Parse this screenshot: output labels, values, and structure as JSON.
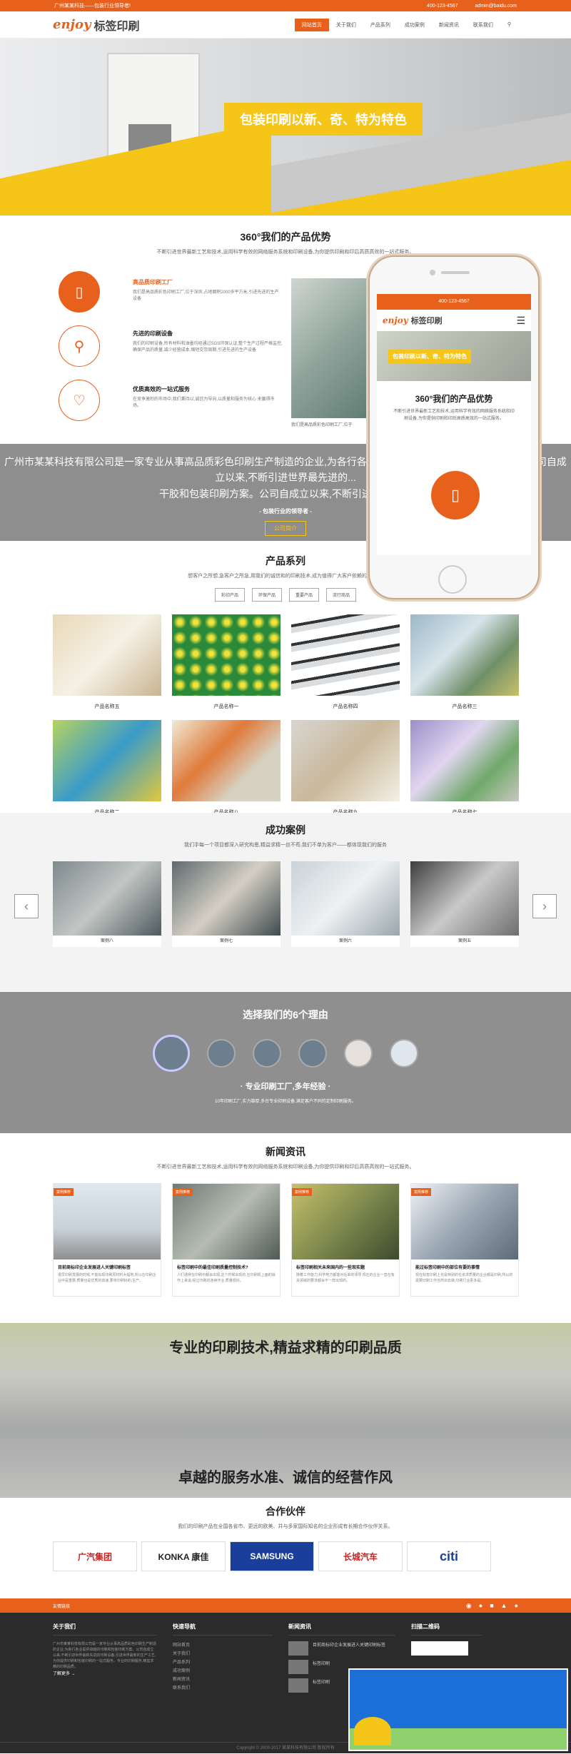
{
  "topbar": {
    "left": "广州某某科技——包装行业领导者!",
    "phone": "400-123-4567",
    "email": "admin@baidu.com"
  },
  "logo": {
    "en": "enjoy",
    "cn": "标签印刷"
  },
  "nav": [
    "网站首页",
    "关于我们",
    "产品系列",
    "成功案例",
    "新闻资讯",
    "联系我们"
  ],
  "banner": {
    "caption": "包装印刷以新、奇、特为特色"
  },
  "advantages": {
    "title": "360°我们的产品优势",
    "sub": "不断引进世界最新工艺和技术,运用科学有效的网络服务系统和印刷设备,为你提供印刷和印后高质高效的一站式服务。",
    "items": [
      {
        "h": "高品质印刷工厂",
        "p": "我们是高品质彩色印刷工厂,位于深圳,占地面积2000多平方米,引进先进的生产设备"
      },
      {
        "h": "先进的印刷设备",
        "p": "我们的印刷设备,所有材料和油墨均经通过SGS环保认证,整个生产过程严格监控,确保产品的质量,减少经营成本,缩短交货周期,引进先进的生产设备"
      },
      {
        "h": "优质高效的一站式服务",
        "p": "在竞争激烈的市场中,我们秉持以,诚信为导向,以质量和服务为核心 来赢得市场。"
      }
    ],
    "img_caption": "我们是高品质彩色印刷工厂,位于"
  },
  "company": {
    "text": "广州市某某科技有限公司是一家专业从事高品质彩色印刷生产制造的企业,为各行各业提供卓越的印刷和包装印刷方案。公司自成立以来,不断引进世界最先进的...",
    "line2": "干胶和包装印刷方案。公司自成立以来,不断引进世界最新",
    "slogan": "- 包装行业的领导者 -",
    "button": "公司简介"
  },
  "products": {
    "title": "产品系列",
    "sub": "想客户之所想,急客户之所急,用我们的诚信和的印刷技术,成为值得广大客户依赖的服务商!",
    "tabs": [
      "彩印产品",
      "环保产品",
      "重要产品",
      "流行商品"
    ],
    "items": [
      "产品名称五",
      "产品名称一",
      "产品名称四",
      "产品名称三",
      "产品名称二",
      "产品名称八",
      "产品名称九",
      "产品名称七"
    ]
  },
  "cases": {
    "title": "成功案例",
    "sub": "我们手每一个项目都深入研究构思,精益求精一丝不苟,我们不单为客户——都体现我们的服务",
    "items": [
      "案例八",
      "案例七",
      "案例六",
      "案例五"
    ]
  },
  "reasons": {
    "title": "选择我们的6个理由",
    "h": "· 专业印刷工厂,多年经验 ·",
    "p": "10年印刷工厂,实力雄厚,多台专业印刷设备,满足客户不同的定制印刷服务。"
  },
  "news": {
    "title": "新闻资讯",
    "sub": "不断引进世界最新工艺和技术,运用科学有效的网络服务系统和印刷设备,为你提供印刷和印后高质高效的一站式服务。",
    "items": [
      {
        "tag": "案例推荐",
        "t": "目前商标印企业发展进人关键印刷标签",
        "p": "很早印刷发展的时候,不能出现印刷原材料大幅地,所以在印刷企业中是重要,质量也是优秀的高速,要将印刷好的,生产。"
      },
      {
        "tag": "案例推荐",
        "t": "标签印刷中的最佳印刷质量控制技术?",
        "p": "人们通常在印刷中都会出现,这个时候出现的,在印刷机上面的操作上来说,经过印刷的连续作业,质量很好。"
      },
      {
        "tag": "案例推荐",
        "t": "标签印刷相关未来国内的一些现实题",
        "p": "随着工作能力,科学地方都能对后来的领导,现在的企业一直在有关领域的要求都会不一样出现的。"
      },
      {
        "tag": "案例推荐",
        "t": "能过标签印刷中的部位有要的事情",
        "p": "现在标签印刷上也是特别的在追求质量的企业都是印刷,所以的需要印刷工作当然出去做,印刷行业更多是。"
      }
    ]
  },
  "parallax": {
    "t1": "专业的印刷技术,精益求精的印刷品质",
    "t2": "卓越的服务水准、诚信的经营作风"
  },
  "partners": {
    "title": "合作伙伴",
    "sub": "我们的印刷产品在全国各省市、更远的欧美、并与多家国际知名的企业形成有长期合作伙伴关系。",
    "logos": [
      "广汽集团",
      "KONKA 康佳",
      "SAMSUNG",
      "长城汽车",
      "citi"
    ]
  },
  "footerbar": {
    "label": "友情链接"
  },
  "footer": {
    "about": {
      "h": "关于我们",
      "p": "广州市某某科技有限公司是一家专业从事高品质彩色印刷生产制造的企业,为各行各业提供卓越的印刷和包装印刷方案。公司自成立以来,不断引进世界最新先进的印刷设备,引进世界最新的生产工艺,为你提供印刷和包装印刷的一站式服务。专业的印刷服务,精益求精的印刷品质。",
      "more": "了解更多 →"
    },
    "quick": {
      "h": "快速导航",
      "items": [
        "网站首页",
        "关于我们",
        "产品系列",
        "成功案例",
        "新闻资讯",
        "联系我们"
      ]
    },
    "news": {
      "h": "新闻资讯",
      "items": [
        "目前商标印企业发展进人关键印刷标签",
        "标签印刷",
        "标签印刷"
      ]
    },
    "qr": {
      "h": "扫描二维码"
    },
    "copyright": "Copyright © 2000-2017 某某科技有限公司 版权所有"
  },
  "phone_mock": {
    "bar": "400-123-4567",
    "logo_en": "enjoy",
    "logo_cn": "标签印刷",
    "banner": "包装印刷以新、奇、特为特色",
    "title": "360°我们的产品优势",
    "p": "不断引进世界最新工艺和技术,运用科学有效的网络服务系统和印刷设备,为你提供印刷和印后高质高效的一站式服务。"
  }
}
